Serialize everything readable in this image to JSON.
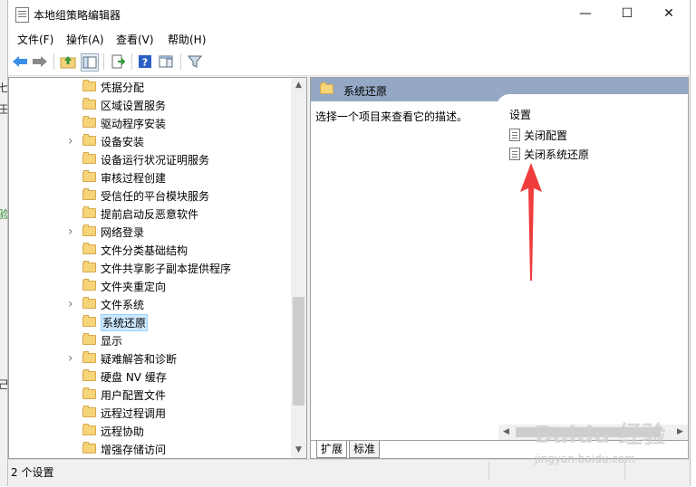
{
  "window": {
    "title": "本地组策略编辑器",
    "controls": {
      "minimize": "—",
      "maximize": "☐",
      "close": "✕"
    }
  },
  "menu": [
    "文件(F)",
    "操作(A)",
    "查看(V)",
    "帮助(H)"
  ],
  "toolbar": {
    "icons": [
      "back-arrow-icon",
      "forward-arrow-icon",
      "up-folder-icon",
      "show-hide-tree-icon",
      "export-list-icon",
      "help-icon",
      "properties-pane-icon",
      "filter-icon"
    ]
  },
  "tree": {
    "items": [
      {
        "label": "凭据分配",
        "expandable": false
      },
      {
        "label": "区域设置服务",
        "expandable": false
      },
      {
        "label": "驱动程序安装",
        "expandable": false
      },
      {
        "label": "设备安装",
        "expandable": true
      },
      {
        "label": "设备运行状况证明服务",
        "expandable": false
      },
      {
        "label": "审核过程创建",
        "expandable": false
      },
      {
        "label": "受信任的平台模块服务",
        "expandable": false
      },
      {
        "label": "提前启动反恶意软件",
        "expandable": false
      },
      {
        "label": "网络登录",
        "expandable": true
      },
      {
        "label": "文件分类基础结构",
        "expandable": false
      },
      {
        "label": "文件共享影子副本提供程序",
        "expandable": false
      },
      {
        "label": "文件夹重定向",
        "expandable": false
      },
      {
        "label": "文件系统",
        "expandable": true
      },
      {
        "label": "系统还原",
        "expandable": false,
        "selected": true
      },
      {
        "label": "显示",
        "expandable": false
      },
      {
        "label": "疑难解答和诊断",
        "expandable": true
      },
      {
        "label": "硬盘 NV 缓存",
        "expandable": false
      },
      {
        "label": "用户配置文件",
        "expandable": false
      },
      {
        "label": "远程过程调用",
        "expandable": false
      },
      {
        "label": "远程协助",
        "expandable": false
      },
      {
        "label": "增强存储访问",
        "expandable": false
      }
    ]
  },
  "details": {
    "header_title": "系统还原",
    "description": "选择一个项目来查看它的描述。",
    "column_header": "设置",
    "settings": [
      "关闭配置",
      "关闭系统还原"
    ],
    "tabs": [
      "扩展",
      "标准"
    ],
    "annotation_color": "#f03c3c"
  },
  "status": {
    "text": "2 个设置"
  },
  "watermark": {
    "main": "Baidu 经验",
    "sub": "jingyan.baidu.com"
  }
}
